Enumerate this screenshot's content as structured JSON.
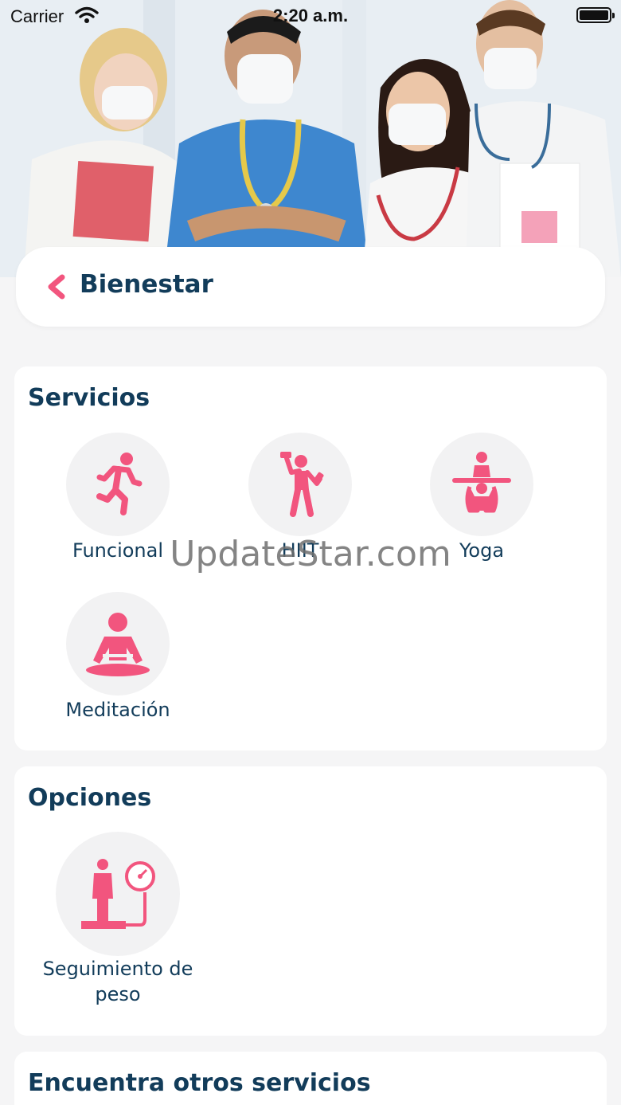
{
  "status_bar": {
    "carrier": "Carrier",
    "time": "2:20 a.m."
  },
  "header": {
    "title": "Bienestar",
    "back_icon": "chevron-left-icon"
  },
  "colors": {
    "accent": "#f2557e",
    "title": "#123c5a",
    "background": "#f5f5f6",
    "icon_bg": "#f2f2f3"
  },
  "servicios": {
    "title": "Servicios",
    "items": [
      {
        "label": "Funcional",
        "icon": "running-person-icon"
      },
      {
        "label": "HIIT",
        "icon": "dumbbell-person-icon"
      },
      {
        "label": "Yoga",
        "icon": "yoga-pose-icon"
      },
      {
        "label": "Meditación",
        "icon": "meditation-icon"
      }
    ]
  },
  "opciones": {
    "title": "Opciones",
    "items": [
      {
        "label": "Seguimiento de peso",
        "icon": "weight-scale-icon"
      }
    ]
  },
  "otros": {
    "title": "Encuentra otros servicios"
  },
  "watermark": "UpdateStar.com"
}
